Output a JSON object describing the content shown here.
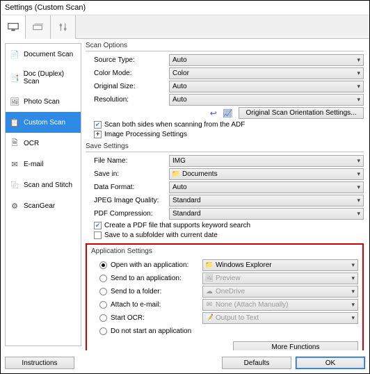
{
  "title": "Settings (Custom Scan)",
  "sidebar": {
    "items": [
      {
        "label": "Document Scan",
        "icon": "📄"
      },
      {
        "label": "Doc (Duplex) Scan",
        "icon": "📑"
      },
      {
        "label": "Photo Scan",
        "icon": "🖼"
      },
      {
        "label": "Custom Scan",
        "icon": "📋"
      },
      {
        "label": "OCR",
        "icon": "🗎"
      },
      {
        "label": "E-mail",
        "icon": "✉"
      },
      {
        "label": "Scan and Stitch",
        "icon": "⿻"
      },
      {
        "label": "ScanGear",
        "icon": "⚙"
      }
    ]
  },
  "scan_options": {
    "title": "Scan Options",
    "source_type": {
      "label": "Source Type:",
      "value": "Auto"
    },
    "color_mode": {
      "label": "Color Mode:",
      "value": "Color"
    },
    "original_size": {
      "label": "Original Size:",
      "value": "Auto"
    },
    "resolution": {
      "label": "Resolution:",
      "value": "Auto"
    },
    "orig_orientation_btn": "Original Scan Orientation Settings...",
    "scan_both": "Scan both sides when scanning from the ADF",
    "image_processing": "Image Processing Settings"
  },
  "save_settings": {
    "title": "Save Settings",
    "file_name": {
      "label": "File Name:",
      "value": "IMG"
    },
    "save_in": {
      "label": "Save in:",
      "value": "Documents"
    },
    "data_format": {
      "label": "Data Format:",
      "value": "Auto"
    },
    "jpeg_quality": {
      "label": "JPEG Image Quality:",
      "value": "Standard"
    },
    "pdf_compression": {
      "label": "PDF Compression:",
      "value": "Standard"
    },
    "pdf_keyword": "Create a PDF file that supports keyword search",
    "subfolder": "Save to a subfolder with current date"
  },
  "app_settings": {
    "title": "Application Settings",
    "open_app": {
      "label": "Open with an application:",
      "value": "Windows Explorer"
    },
    "send_app": {
      "label": "Send to an application:",
      "value": "Preview"
    },
    "send_folder": {
      "label": "Send to a folder:",
      "value": "OneDrive"
    },
    "attach_email": {
      "label": "Attach to e-mail:",
      "value": "None (Attach Manually)"
    },
    "start_ocr": {
      "label": "Start OCR:",
      "value": "Output to Text"
    },
    "no_app": "Do not start an application",
    "more_fn": "More Functions"
  },
  "footer": {
    "instructions": "Instructions",
    "defaults": "Defaults",
    "ok": "OK"
  }
}
